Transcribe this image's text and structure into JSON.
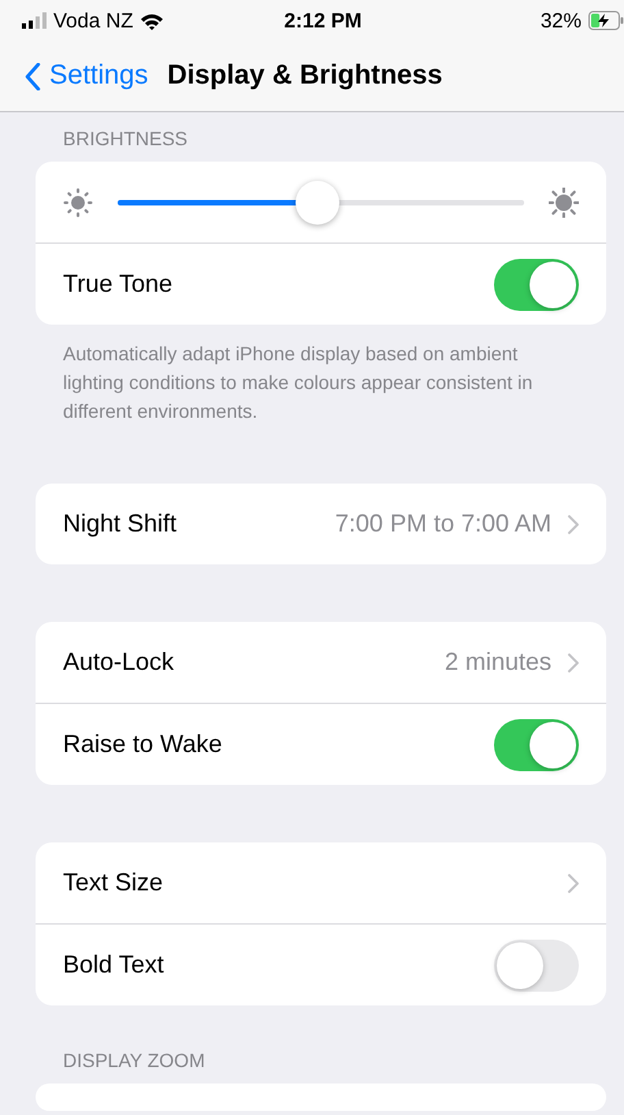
{
  "status_bar": {
    "carrier": "Voda NZ",
    "time": "2:12 PM",
    "battery": "32%",
    "charging": true
  },
  "nav": {
    "back": "Settings",
    "title": "Display & Brightness"
  },
  "sections": [
    {
      "header": "BRIGHTNESS",
      "rows": [
        {
          "kind": "slider",
          "level": 0.49
        },
        {
          "kind": "toggle",
          "label": "True Tone",
          "on": true
        }
      ],
      "footer": "Automatically adapt iPhone display based on ambient lighting conditions to make colours appear consistent in different environments."
    },
    {
      "rows": [
        {
          "kind": "value",
          "label": "Night Shift",
          "value": "7:00 PM to 7:00 AM"
        }
      ]
    },
    {
      "rows": [
        {
          "kind": "value",
          "label": "Auto-Lock",
          "value": "2 minutes"
        },
        {
          "kind": "toggle",
          "label": "Raise to Wake",
          "on": true
        }
      ]
    },
    {
      "rows": [
        {
          "kind": "value",
          "label": "Text Size"
        },
        {
          "kind": "toggle",
          "label": "Bold Text",
          "on": false
        }
      ]
    },
    {
      "header": "DISPLAY ZOOM",
      "card": true
    }
  ]
}
